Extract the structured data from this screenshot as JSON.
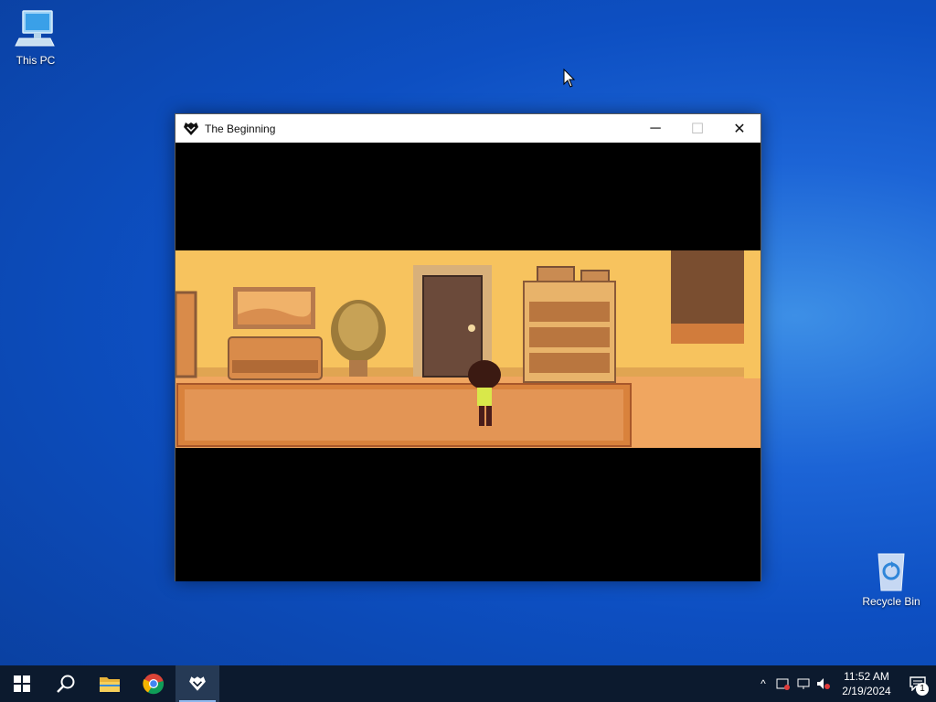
{
  "desktop": {
    "icons": [
      {
        "label": "This PC",
        "icon": "computer-icon"
      },
      {
        "label": "Recycle Bin",
        "icon": "recycle-bin-icon"
      }
    ]
  },
  "window": {
    "title": "The Beginning",
    "app_icon": "heart-emblem-icon",
    "controls": {
      "minimize": "─",
      "maximize": "☐",
      "close": "✕"
    }
  },
  "game": {
    "scene": "hallway-room",
    "colors": {
      "wall": "#f7c35e",
      "floor": "#f0a660",
      "rug": "#d9823c",
      "door": "#6b4a3a",
      "player_shirt": "#d9e84a"
    }
  },
  "taskbar": {
    "start_icon": "windows-logo-icon",
    "search_icon": "search-icon",
    "pinned": [
      {
        "name": "file-explorer",
        "icon": "folder-icon"
      },
      {
        "name": "chrome",
        "icon": "chrome-icon"
      },
      {
        "name": "the-beginning",
        "icon": "heart-emblem-icon",
        "active": true
      }
    ],
    "tray": {
      "chevron": "^",
      "time": "11:52 AM",
      "date": "2/19/2024",
      "notification_count": "1"
    }
  }
}
